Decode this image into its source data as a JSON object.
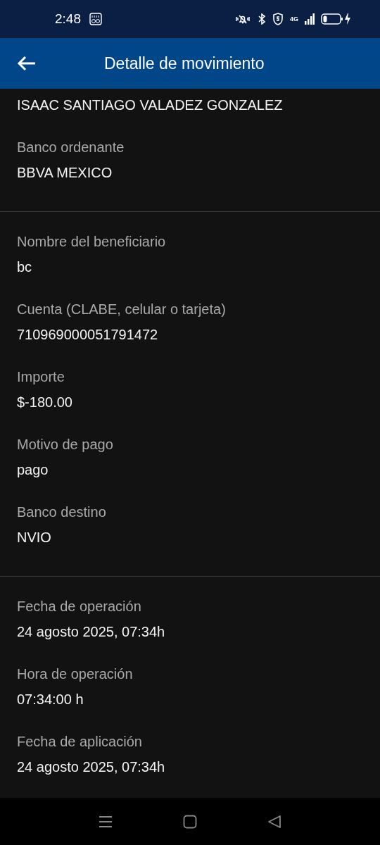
{
  "status_bar": {
    "time": "2:48",
    "network": "4G"
  },
  "app_bar": {
    "title": "Detalle de movimiento"
  },
  "sections": [
    {
      "fields": [
        {
          "value": "ISAAC SANTIAGO VALADEZ GONZALEZ"
        },
        {
          "label": "Banco ordenante",
          "value": "BBVA MEXICO"
        }
      ]
    },
    {
      "fields": [
        {
          "label": "Nombre del beneficiario",
          "value": "bc"
        },
        {
          "label": "Cuenta (CLABE, celular o tarjeta)",
          "value": "710969000051791472"
        },
        {
          "label": "Importe",
          "value": "$-180.00"
        },
        {
          "label": "Motivo de pago",
          "value": "pago"
        },
        {
          "label": "Banco destino",
          "value": "NVIO"
        }
      ]
    },
    {
      "fields": [
        {
          "label": "Fecha de operación",
          "value": "24 agosto 2025, 07:34h"
        },
        {
          "label": "Hora de operación",
          "value": "07:34:00 h"
        },
        {
          "label": "Fecha de aplicación",
          "value": "24 agosto 2025, 07:34h"
        }
      ]
    }
  ]
}
